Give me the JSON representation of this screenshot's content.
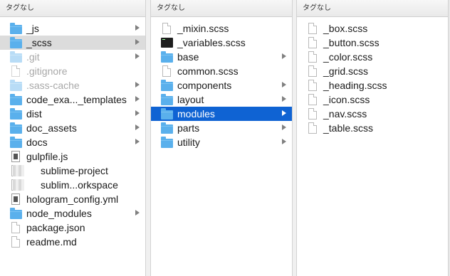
{
  "columns": [
    {
      "header": "タグなし",
      "items": [
        {
          "name": "_js",
          "icon": "folder-icon",
          "arrow": true
        },
        {
          "name": "_scss",
          "icon": "folder-icon",
          "arrow": true,
          "selected": "gray"
        },
        {
          "name": ".git",
          "icon": "folder-light-icon",
          "arrow": true,
          "dim": true
        },
        {
          "name": ".gitignore",
          "icon": "document-icon",
          "dim": true
        },
        {
          "name": ".sass-cache",
          "icon": "folder-light-icon",
          "arrow": true,
          "dim": true
        },
        {
          "name": "code_exa..._templates",
          "icon": "folder-icon",
          "arrow": true
        },
        {
          "name": "dist",
          "icon": "folder-icon",
          "arrow": true
        },
        {
          "name": "doc_assets",
          "icon": "folder-icon",
          "arrow": true
        },
        {
          "name": "docs",
          "icon": "folder-icon",
          "arrow": true
        },
        {
          "name": "gulpfile.js",
          "icon": "js-file-icon"
        },
        {
          "name": "sublime-project",
          "icon": "document-icon",
          "blurred": true
        },
        {
          "name": "sublim...orkspace",
          "icon": "document-icon",
          "blurred": true
        },
        {
          "name": "hologram_config.yml",
          "icon": "config-file-icon"
        },
        {
          "name": "node_modules",
          "icon": "folder-icon",
          "arrow": true
        },
        {
          "name": "package.json",
          "icon": "document-icon"
        },
        {
          "name": "readme.md",
          "icon": "document-icon"
        }
      ]
    },
    {
      "header": "タグなし",
      "items": [
        {
          "name": "_mixin.scss",
          "icon": "document-icon"
        },
        {
          "name": "_variables.scss",
          "icon": "terminal-icon"
        },
        {
          "name": "base",
          "icon": "folder-icon",
          "arrow": true
        },
        {
          "name": "common.scss",
          "icon": "document-icon"
        },
        {
          "name": "components",
          "icon": "folder-icon",
          "arrow": true
        },
        {
          "name": "layout",
          "icon": "folder-icon",
          "arrow": true
        },
        {
          "name": "modules",
          "icon": "folder-icon",
          "arrow": true,
          "selected": "blue"
        },
        {
          "name": "parts",
          "icon": "folder-icon",
          "arrow": true
        },
        {
          "name": "utility",
          "icon": "folder-icon",
          "arrow": true
        }
      ]
    },
    {
      "header": "タグなし",
      "items": [
        {
          "name": "_box.scss",
          "icon": "document-icon"
        },
        {
          "name": "_button.scss",
          "icon": "document-icon"
        },
        {
          "name": "_color.scss",
          "icon": "document-icon"
        },
        {
          "name": "_grid.scss",
          "icon": "document-icon"
        },
        {
          "name": "_heading.scss",
          "icon": "document-icon"
        },
        {
          "name": "_icon.scss",
          "icon": "document-icon"
        },
        {
          "name": "_nav.scss",
          "icon": "document-icon"
        },
        {
          "name": "_table.scss",
          "icon": "document-icon"
        }
      ]
    }
  ],
  "colors": {
    "selection_blue": "#0f63d3",
    "selection_gray": "#dcdcdc",
    "folder": "#5ab0ec"
  }
}
